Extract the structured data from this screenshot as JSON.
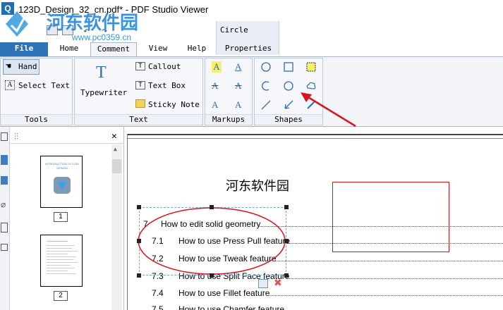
{
  "window": {
    "title": "123D_Design_32_cn.pdf* - PDF Studio Viewer",
    "app_icon": "Q"
  },
  "watermark": {
    "text": "河东软件园",
    "url": "www.pc0359.cn"
  },
  "contextual_group": {
    "label": "Circle"
  },
  "tabs": [
    {
      "label": "File"
    },
    {
      "label": "Home"
    },
    {
      "label": "Comment"
    },
    {
      "label": "View"
    },
    {
      "label": "Help"
    },
    {
      "label": "Properties"
    }
  ],
  "ribbon": {
    "tools": {
      "label": "Tools",
      "hand": "Hand",
      "select_text": "Select Text"
    },
    "text": {
      "label": "Text",
      "typewriter": "Typewriter",
      "callout": "Callout",
      "text_box": "Text Box",
      "sticky_note": "Sticky Note"
    },
    "markups": {
      "label": "Markups"
    },
    "shapes": {
      "label": "Shapes"
    }
  },
  "thumbnails": [
    {
      "page": "1",
      "caption": "INTRODUCTION TO 123D DESIGN"
    },
    {
      "page": "2"
    }
  ],
  "document": {
    "title": "河东软件园",
    "toc": [
      {
        "num": "7",
        "text": "How to edit solid geometry"
      },
      {
        "num": "7.1",
        "text": "How to use Press Pull feature"
      },
      {
        "num": "7.2",
        "text": "How to use Tweak feature"
      },
      {
        "num": "7.3",
        "text": "How to use Split Face feature"
      },
      {
        "num": "7.4",
        "text": "How to use Fillet feature"
      },
      {
        "num": "7.5",
        "text": "How to use Chamfer feature"
      }
    ]
  },
  "colors": {
    "accent": "#2c73b8",
    "annotation_red": "#d9141b",
    "selection": "#6fa8dc"
  }
}
